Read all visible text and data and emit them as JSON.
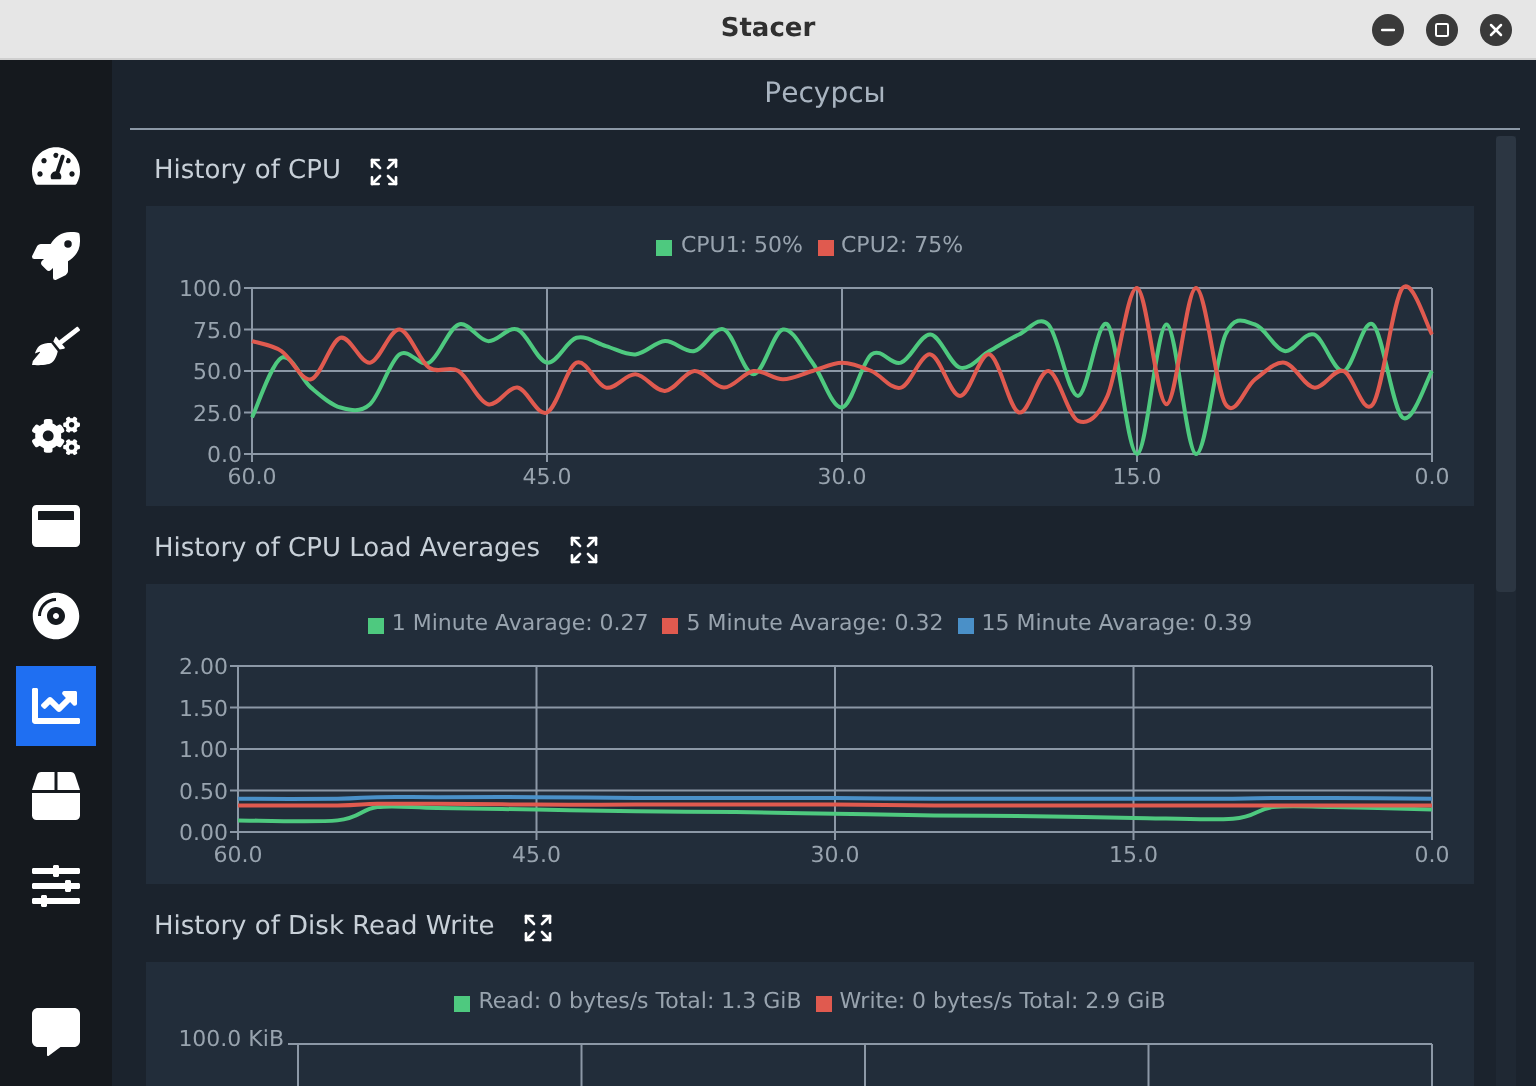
{
  "window": {
    "title": "Stacer"
  },
  "sidebar": {
    "items": [
      {
        "selected": false
      },
      {
        "selected": false
      },
      {
        "selected": false
      },
      {
        "selected": false
      },
      {
        "selected": false
      },
      {
        "selected": false
      },
      {
        "selected": true
      },
      {
        "selected": false
      },
      {
        "selected": false
      },
      {
        "selected": false
      }
    ]
  },
  "page": {
    "title": "Ресурсы"
  },
  "sections": [
    {
      "title": "History of CPU",
      "chart_data": {
        "type": "line",
        "grid": true,
        "legend": "top",
        "x": [
          60,
          58.5,
          57,
          55.5,
          54,
          52.5,
          51,
          49.5,
          48,
          46.5,
          45,
          43.5,
          42,
          40.5,
          39,
          37.5,
          36,
          34.5,
          33,
          31.5,
          30,
          28.5,
          27,
          25.5,
          24,
          22.5,
          21,
          19.5,
          18,
          16.5,
          15,
          13.5,
          12,
          10.5,
          9,
          7.5,
          6,
          4.5,
          3,
          1.5,
          0
        ],
        "xlim": [
          60,
          0
        ],
        "ylim": [
          0,
          100
        ],
        "xticks": [
          {
            "value": 60,
            "label": "60.0"
          },
          {
            "value": 45,
            "label": "45.0"
          },
          {
            "value": 30,
            "label": "30.0"
          },
          {
            "value": 15,
            "label": "15.0"
          },
          {
            "value": 0,
            "label": "0.0"
          }
        ],
        "yticks": [
          {
            "value": 0,
            "label": "0.0"
          },
          {
            "value": 25,
            "label": "25.0"
          },
          {
            "value": 50,
            "label": "50.0"
          },
          {
            "value": 75,
            "label": "75.0"
          },
          {
            "value": 100,
            "label": "100.0"
          }
        ],
        "series": [
          {
            "name": "CPU1: 50%",
            "color": "#4ec97f",
            "values": [
              22,
              58,
              40,
              28,
              30,
              60,
              55,
              78,
              68,
              75,
              55,
              70,
              65,
              60,
              68,
              62,
              75,
              48,
              75,
              55,
              28,
              60,
              55,
              72,
              52,
              62,
              72,
              78,
              35,
              78,
              0,
              78,
              0,
              72,
              78,
              62,
              72,
              50,
              78,
              22,
              50
            ]
          },
          {
            "name": "CPU2: 75%",
            "color": "#e05a4f",
            "values": [
              68,
              62,
              45,
              70,
              55,
              75,
              52,
              50,
              30,
              40,
              25,
              55,
              40,
              48,
              38,
              50,
              40,
              50,
              45,
              50,
              55,
              50,
              40,
              60,
              35,
              60,
              25,
              50,
              20,
              35,
              100,
              30,
              100,
              30,
              45,
              55,
              40,
              50,
              30,
              100,
              72
            ]
          }
        ]
      }
    },
    {
      "title": "History of CPU Load Averages",
      "chart_data": {
        "type": "line",
        "grid": true,
        "legend": "top",
        "x": [
          60,
          55,
          53,
          50,
          45,
          40,
          35,
          30,
          25,
          20,
          15,
          10,
          8,
          5,
          0
        ],
        "xlim": [
          60,
          0
        ],
        "ylim": [
          0,
          2
        ],
        "xticks": [
          {
            "value": 60,
            "label": "60.0"
          },
          {
            "value": 45,
            "label": "45.0"
          },
          {
            "value": 30,
            "label": "30.0"
          },
          {
            "value": 15,
            "label": "15.0"
          },
          {
            "value": 0,
            "label": "0.0"
          }
        ],
        "yticks": [
          {
            "value": 0,
            "label": "0.00"
          },
          {
            "value": 0.5,
            "label": "0.50"
          },
          {
            "value": 1,
            "label": "1.00"
          },
          {
            "value": 1.5,
            "label": "1.50"
          },
          {
            "value": 2,
            "label": "2.00"
          }
        ],
        "series": [
          {
            "name": "1 Minute Avarage: 0.27",
            "color": "#4ec97f",
            "values": [
              0.14,
              0.14,
              0.3,
              0.29,
              0.27,
              0.25,
              0.24,
              0.22,
              0.2,
              0.19,
              0.17,
              0.16,
              0.3,
              0.3,
              0.27
            ]
          },
          {
            "name": "5 Minute Avarage: 0.32",
            "color": "#e05a4f",
            "values": [
              0.32,
              0.32,
              0.34,
              0.34,
              0.33,
              0.33,
              0.33,
              0.33,
              0.32,
              0.32,
              0.32,
              0.32,
              0.32,
              0.32,
              0.32
            ]
          },
          {
            "name": "15 Minute Avarage: 0.39",
            "color": "#4a90c8",
            "values": [
              0.4,
              0.4,
              0.42,
              0.42,
              0.42,
              0.41,
              0.41,
              0.41,
              0.4,
              0.4,
              0.4,
              0.4,
              0.41,
              0.41,
              0.4
            ]
          }
        ]
      }
    },
    {
      "title": "History of Disk Read Write",
      "cut_chart": {
        "top_label": "100.0 KiB",
        "legend": [
          {
            "name": "Read: 0 bytes/s Total: 1.3 GiB",
            "color": "#4ec97f"
          },
          {
            "name": "Write: 0 bytes/s Total: 2.9 GiB",
            "color": "#e05a4f"
          }
        ]
      }
    }
  ]
}
